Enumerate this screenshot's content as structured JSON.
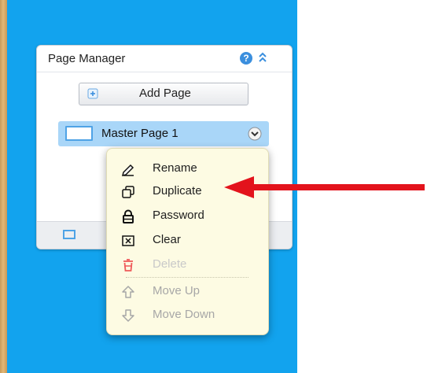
{
  "panel": {
    "title": "Page Manager",
    "help_icon": "?",
    "add_page_label": "Add Page",
    "page_item": {
      "label": "Master Page 1"
    }
  },
  "context_menu": {
    "items": [
      {
        "label": "Rename",
        "icon": "pencil-icon",
        "enabled": true
      },
      {
        "label": "Duplicate",
        "icon": "duplicate-icon",
        "enabled": true
      },
      {
        "label": "Password",
        "icon": "lock-icon",
        "enabled": true
      },
      {
        "label": "Clear",
        "icon": "clear-icon",
        "enabled": true
      },
      {
        "label": "Delete",
        "icon": "trash-icon",
        "enabled": false
      },
      {
        "label": "Move Up",
        "icon": "arrow-up-icon",
        "enabled": false
      },
      {
        "label": "Move Down",
        "icon": "arrow-down-icon",
        "enabled": false
      }
    ]
  },
  "colors": {
    "canvas": "#12a3ee",
    "page_item_highlight": "#a9d6f8",
    "menu_background": "#fdfbe3",
    "arrow": "#e3131c",
    "delete_icon": "#ef5a5a"
  }
}
